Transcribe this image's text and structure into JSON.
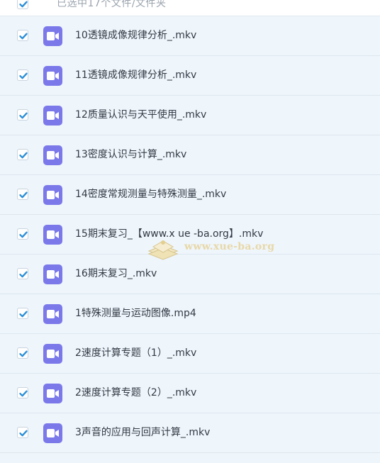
{
  "header": {
    "selection_text": "已选中17个文件/文件夹"
  },
  "files": [
    {
      "name": "10透镜成像规律分析_.mkv",
      "checked": true
    },
    {
      "name": "11透镜成像规律分析_.mkv",
      "checked": true
    },
    {
      "name": "12质量认识与天平使用_.mkv",
      "checked": true
    },
    {
      "name": "13密度认识与计算_.mkv",
      "checked": true
    },
    {
      "name": "14密度常规测量与特殊测量_.mkv",
      "checked": true
    },
    {
      "name": "15期末复习_【www.x ue -ba.org】.mkv",
      "checked": true
    },
    {
      "name": "16期末复习_.mkv",
      "checked": true
    },
    {
      "name": "1特殊测量与运动图像.mp4",
      "checked": true
    },
    {
      "name": "2速度计算专题（1）_.mkv",
      "checked": true
    },
    {
      "name": "2速度计算专题（2）_.mkv",
      "checked": true
    },
    {
      "name": "3声音的应用与回声计算_.mkv",
      "checked": true
    }
  ],
  "watermark": {
    "text": "www.xue-ba.org"
  },
  "colors": {
    "checkbox_check": "#2b8fd8",
    "video_icon_bg": "#7b79ea",
    "row_bg": "#eef5fb",
    "text": "#333a44"
  },
  "icons": {
    "checkbox": "checkbox-checked-icon",
    "file": "video-file-icon"
  }
}
